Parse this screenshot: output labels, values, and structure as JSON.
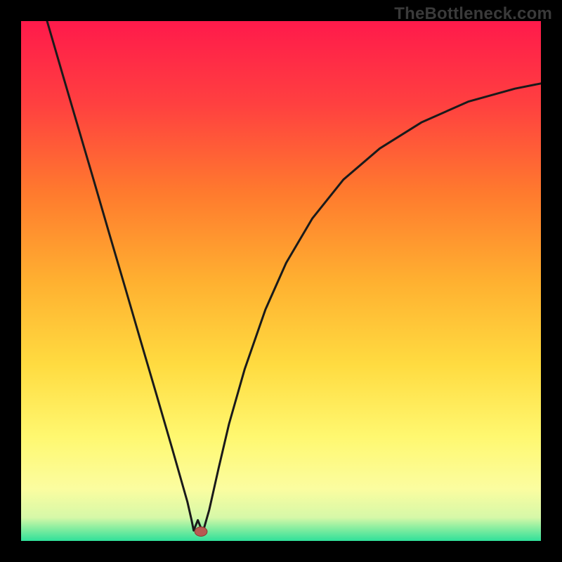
{
  "watermark": "TheBottleneck.com",
  "colors": {
    "frame_bg": "#000000",
    "curve_stroke": "#1a1a1a",
    "marker_fill": "#b75a52",
    "marker_stroke": "#8a3a32"
  },
  "chart_data": {
    "type": "line",
    "title": "",
    "xlabel": "",
    "ylabel": "",
    "xlim": [
      0,
      1
    ],
    "ylim": [
      0,
      1
    ],
    "gradient_stops": [
      {
        "offset": 0.0,
        "color": "#ff1a4b"
      },
      {
        "offset": 0.16,
        "color": "#ff4040"
      },
      {
        "offset": 0.33,
        "color": "#ff7a2e"
      },
      {
        "offset": 0.5,
        "color": "#ffb030"
      },
      {
        "offset": 0.66,
        "color": "#ffdb40"
      },
      {
        "offset": 0.8,
        "color": "#fff870"
      },
      {
        "offset": 0.9,
        "color": "#fbfda0"
      },
      {
        "offset": 0.955,
        "color": "#d6f8a8"
      },
      {
        "offset": 0.975,
        "color": "#8aeea0"
      },
      {
        "offset": 1.0,
        "color": "#30e09a"
      }
    ],
    "series": [
      {
        "name": "bottleneck-curve",
        "x": [
          0.05,
          0.08,
          0.11,
          0.14,
          0.17,
          0.2,
          0.23,
          0.26,
          0.29,
          0.31,
          0.32,
          0.328,
          0.332,
          0.34,
          0.348,
          0.346,
          0.35,
          0.362,
          0.38,
          0.4,
          0.43,
          0.47,
          0.51,
          0.56,
          0.62,
          0.69,
          0.77,
          0.86,
          0.95,
          1.0
        ],
        "y": [
          1.0,
          0.897,
          0.795,
          0.693,
          0.59,
          0.488,
          0.385,
          0.283,
          0.18,
          0.11,
          0.075,
          0.04,
          0.02,
          0.04,
          0.02,
          0.018,
          0.018,
          0.06,
          0.14,
          0.225,
          0.33,
          0.445,
          0.535,
          0.62,
          0.695,
          0.755,
          0.805,
          0.845,
          0.87,
          0.88
        ]
      }
    ],
    "marker": {
      "x": 0.346,
      "y": 0.018,
      "r": 0.012
    }
  }
}
